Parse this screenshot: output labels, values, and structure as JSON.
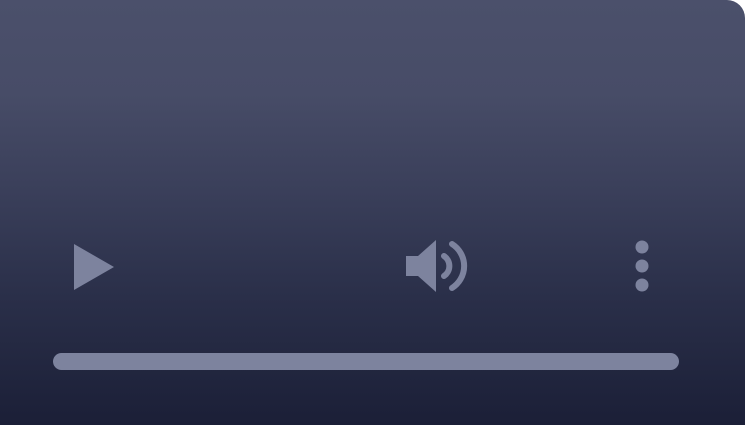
{
  "player": {
    "controls": {
      "play": {
        "icon": "play-icon"
      },
      "volume": {
        "icon": "volume-icon"
      },
      "more": {
        "icon": "more-vertical-icon"
      }
    },
    "progress": {
      "value": 0
    }
  },
  "colors": {
    "background_top": "#4b506b",
    "background_bottom": "#1b1f37",
    "control": "#7d839e"
  }
}
